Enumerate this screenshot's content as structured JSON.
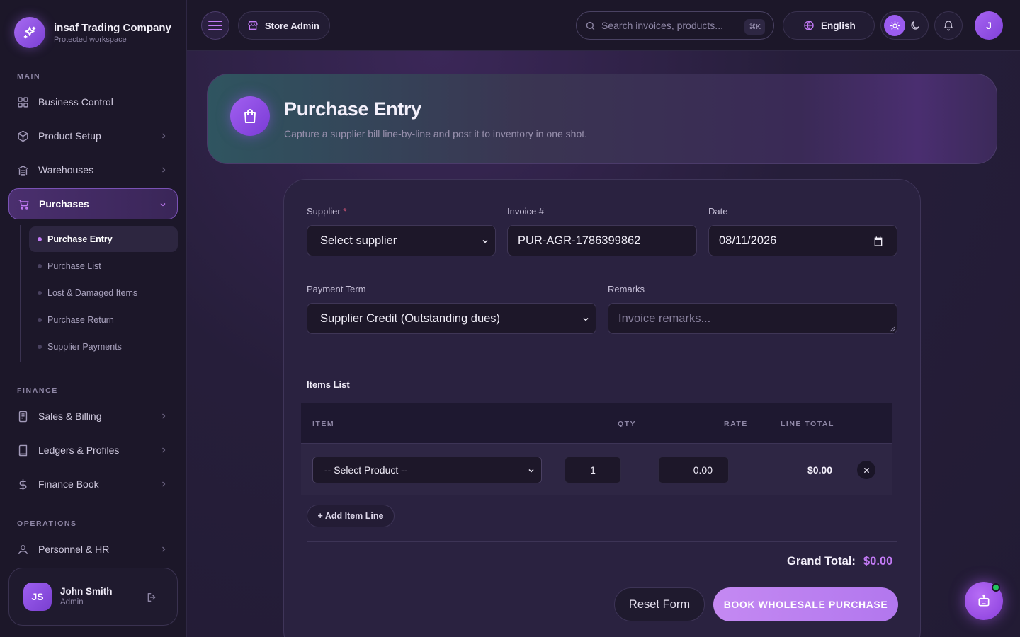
{
  "colors": {
    "accent": "#9b5cf0",
    "accent_light": "#c27af5",
    "background": "#221b34",
    "online": "#22c55e"
  },
  "brand": {
    "name": "insaf Trading Company",
    "subtitle": "Protected workspace",
    "icon": "sparkle-icon"
  },
  "sidebar": {
    "sections": {
      "main": "MAIN",
      "finance": "FINANCE",
      "operations": "OPERATIONS"
    },
    "items": [
      {
        "label": "Business Control",
        "icon": "grid-icon"
      },
      {
        "label": "Product Setup",
        "icon": "box-icon"
      },
      {
        "label": "Warehouses",
        "icon": "warehouse-icon"
      },
      {
        "label": "Purchases",
        "icon": "cart-icon",
        "active": true
      },
      {
        "label": "Sales & Billing",
        "icon": "receipt-icon"
      },
      {
        "label": "Ledgers & Profiles",
        "icon": "book-icon"
      },
      {
        "label": "Finance Book",
        "icon": "dollar-icon"
      },
      {
        "label": "Personnel & HR",
        "icon": "user-icon"
      }
    ],
    "purchases_sub": [
      {
        "label": "Purchase Entry",
        "active": true
      },
      {
        "label": "Purchase List"
      },
      {
        "label": "Lost & Damaged Items"
      },
      {
        "label": "Purchase Return"
      },
      {
        "label": "Supplier Payments"
      }
    ]
  },
  "user": {
    "initials": "JS",
    "name": "John Smith",
    "role": "Admin"
  },
  "topbar": {
    "store_label": "Store Admin",
    "search_placeholder": "Search invoices, products...",
    "search_shortcut": "⌘K",
    "language": "English",
    "profile_initial": "J"
  },
  "hero": {
    "title": "Purchase Entry",
    "subtitle": "Capture a supplier bill line-by-line and post it to inventory in one shot."
  },
  "form": {
    "supplier": {
      "label": "Supplier",
      "required_mark": "*",
      "value": "Select supplier"
    },
    "invoice": {
      "label": "Invoice #",
      "value": "PUR-AGR-1786399862"
    },
    "date": {
      "label": "Date",
      "value": "08/11/2026"
    },
    "payment_term": {
      "label": "Payment Term",
      "value": "Supplier Credit (Outstanding dues)"
    },
    "remarks": {
      "label": "Remarks",
      "placeholder": "Invoice remarks..."
    }
  },
  "items": {
    "title": "Items List",
    "headers": {
      "item": "ITEM",
      "qty": "QTY",
      "rate": "RATE",
      "line_total": "LINE TOTAL"
    },
    "rows": [
      {
        "product": "-- Select Product --",
        "qty": "1",
        "rate": "0.00",
        "line_total": "$0.00"
      }
    ],
    "add_label": "+ Add Item Line"
  },
  "totals": {
    "grand_label": "Grand Total:",
    "grand_value": "$0.00"
  },
  "actions": {
    "reset": "Reset Form",
    "submit": "BOOK WHOLESALE PURCHASE"
  }
}
